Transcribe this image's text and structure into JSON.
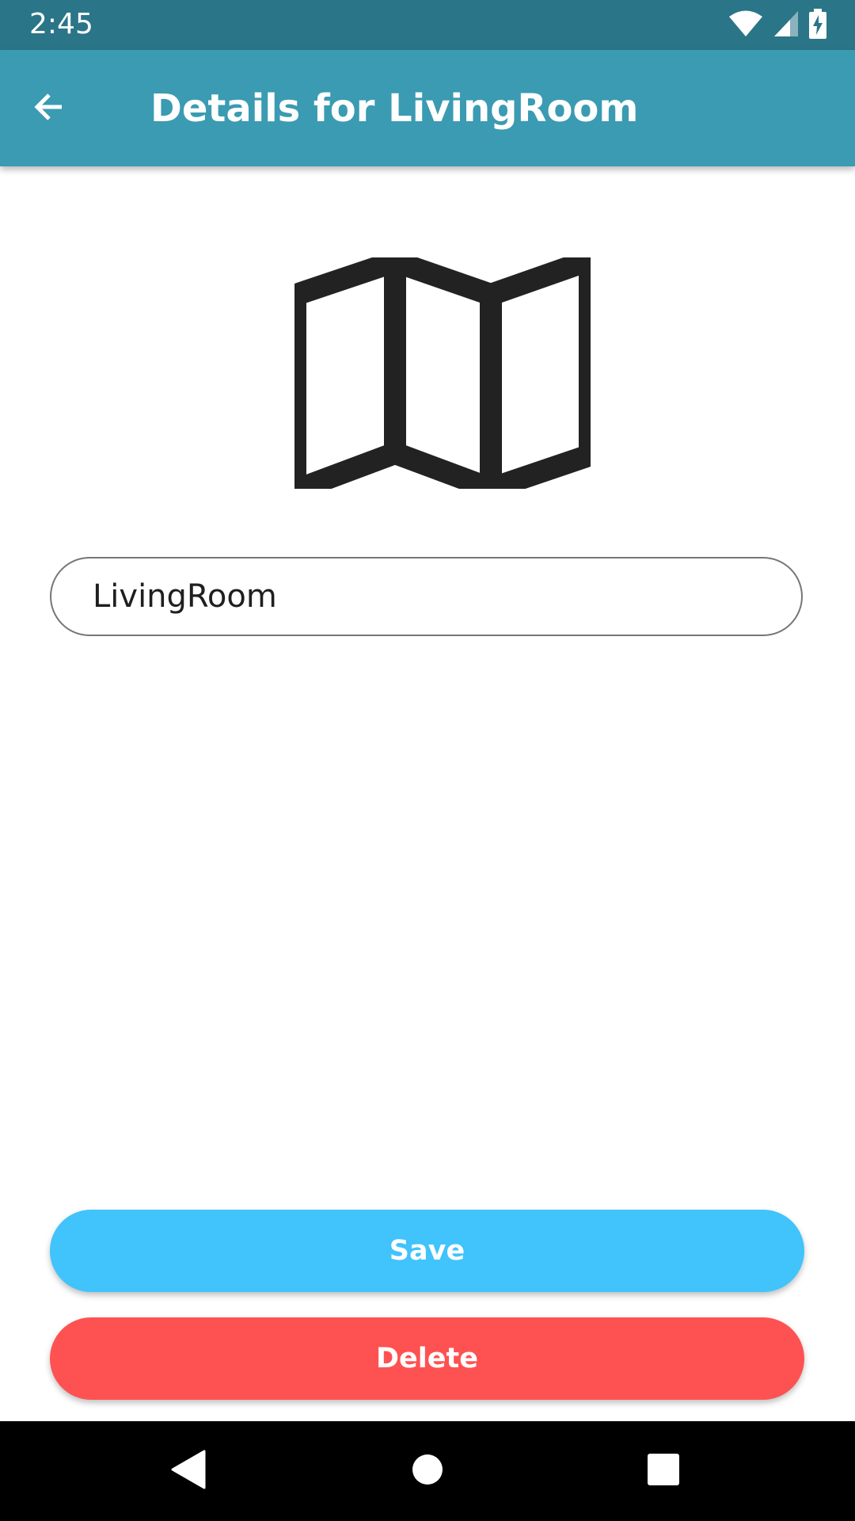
{
  "status_bar": {
    "time": "2:45",
    "icons": [
      "wifi-icon",
      "cellular-signal-icon",
      "battery-charging-icon"
    ]
  },
  "app_bar": {
    "back_icon": "arrow-back-icon",
    "title": "Details for LivingRoom"
  },
  "content": {
    "icon": "map-icon",
    "name_field": {
      "value": "LivingRoom",
      "placeholder": ""
    }
  },
  "actions": {
    "save_label": "Save",
    "delete_label": "Delete"
  },
  "nav_bar": {
    "icons": [
      "nav-back-icon",
      "nav-home-icon",
      "nav-recents-icon"
    ]
  },
  "colors": {
    "status_bar": "#2b7588",
    "app_bar": "#3a9bb2",
    "save_button": "#41c3fb",
    "delete_button": "#fe5252",
    "nav_bar": "#000000"
  }
}
